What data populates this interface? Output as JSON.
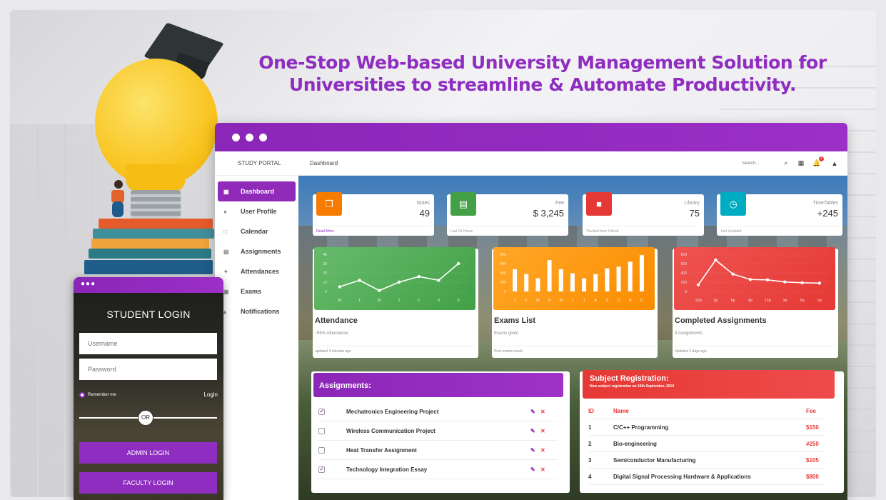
{
  "headline": {
    "line1": "One-Stop Web-based University Management Solution for",
    "line2": "Universities to streamline & Automate Productivity."
  },
  "topnav": {
    "brand": "STUDY PORTAL",
    "breadcrumb": "Dashboard",
    "search_placeholder": "Search...",
    "notification_count": "2"
  },
  "sidebar": {
    "items": [
      {
        "label": "Dashboard",
        "icon": "dashboard-icon"
      },
      {
        "label": "User Profile",
        "icon": "user-icon"
      },
      {
        "label": "Calendar",
        "icon": "calendar-icon"
      },
      {
        "label": "Assignments",
        "icon": "assignments-icon"
      },
      {
        "label": "Attendances",
        "icon": "attendance-icon"
      },
      {
        "label": "Exams",
        "icon": "exams-icon"
      },
      {
        "label": "Notifications",
        "icon": "bell-icon"
      }
    ]
  },
  "stats": [
    {
      "label": "Notes",
      "value": "49",
      "footer": "Read More",
      "color": "#f57c00",
      "icon": "copy-icon"
    },
    {
      "label": "Fee",
      "value": "$ 3,245",
      "footer": "Last 24 Hours",
      "color": "#43a047",
      "icon": "store-icon"
    },
    {
      "label": "Library",
      "value": "75",
      "footer": "Tracked from Github",
      "color": "#e53935",
      "icon": "book-icon"
    },
    {
      "label": "TimeTables",
      "value": "+245",
      "footer": "Just Updated",
      "color": "#00acc1",
      "icon": "clock-icon"
    }
  ],
  "charts_meta": [
    {
      "title": "Attendance",
      "subtitle": "55% Attendance",
      "footer": "updated 4 minutes ago"
    },
    {
      "title": "Exams List",
      "subtitle": "Exams given",
      "footer": "Post exams result"
    },
    {
      "title": "Completed Assignments",
      "subtitle": "3 Assignments",
      "footer": "Updated 2 days ago"
    }
  ],
  "chart_data": [
    {
      "type": "line",
      "categories": [
        "M",
        "T",
        "W",
        "T",
        "F",
        "S",
        "S"
      ],
      "values": [
        5,
        12,
        1,
        10,
        16,
        12,
        30
      ],
      "yticks": [
        "40",
        "30",
        "20",
        "10",
        "0"
      ],
      "ylim": [
        0,
        40
      ],
      "color": "#4caf50"
    },
    {
      "type": "bar",
      "categories": [
        "J",
        "F",
        "M",
        "A",
        "M",
        "J",
        "J",
        "A",
        "S",
        "O",
        "N",
        "D"
      ],
      "values": [
        540,
        420,
        320,
        760,
        540,
        440,
        320,
        420,
        560,
        600,
        720,
        880
      ],
      "yticks": [
        "800",
        "600",
        "400",
        "200",
        "0"
      ],
      "ylim": [
        0,
        900
      ],
      "color": "#ff9800"
    },
    {
      "type": "line",
      "categories": [
        "12p",
        "3p",
        "6p",
        "9p",
        "12p",
        "3a",
        "6a",
        "9a"
      ],
      "values": [
        160,
        760,
        420,
        290,
        280,
        230,
        210,
        200
      ],
      "yticks": [
        "800",
        "600",
        "400",
        "200",
        "0"
      ],
      "ylim": [
        0,
        900
      ],
      "color": "#f44336"
    }
  ],
  "assignments": {
    "title": "Assignments:",
    "items": [
      {
        "name": "Mechatronics Engineering Project",
        "checked": true
      },
      {
        "name": "Wireless Communication Project",
        "checked": false
      },
      {
        "name": "Heat Transfer Assignment",
        "checked": false
      },
      {
        "name": "Technology Integration Essay",
        "checked": true
      }
    ]
  },
  "registration": {
    "title": "Subject Registration:",
    "subtitle": "New subject registration on 15th September, 2019",
    "headers": {
      "id": "ID",
      "name": "Name",
      "fee": "Fee"
    },
    "rows": [
      {
        "id": "1",
        "name": "C/C++ Programming",
        "fee": "$150"
      },
      {
        "id": "2",
        "name": "Bio-engineering",
        "fee": "#250"
      },
      {
        "id": "3",
        "name": "Semiconductor Manufacturing",
        "fee": "$105"
      },
      {
        "id": "4",
        "name": "Digital Signal Processing Hardware & Applications",
        "fee": "$800"
      }
    ]
  },
  "login": {
    "title": "STUDENT LOGIN",
    "username_placeholder": "Username",
    "password_placeholder": "Password",
    "remember": "Remember me",
    "login": "Login",
    "or": "OR",
    "admin": "ADMIN LOGIN",
    "faculty": "FACULTY LOGIN"
  }
}
